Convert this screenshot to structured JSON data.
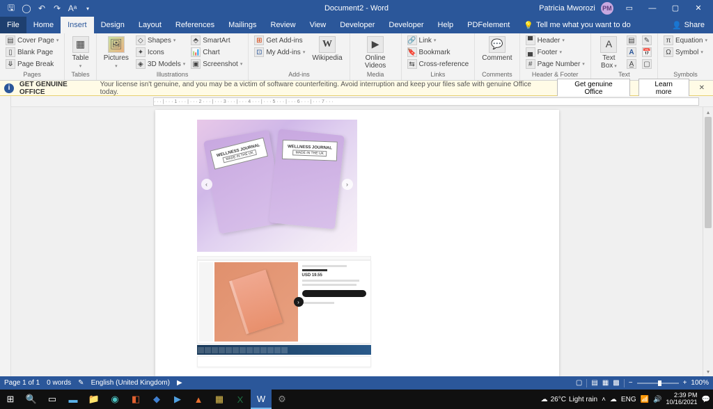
{
  "titlebar": {
    "doc_title": "Document2 - Word",
    "user_name": "Patricia Mworozi",
    "user_initials": "PM"
  },
  "tabs": {
    "file": "File",
    "items": [
      "Home",
      "Insert",
      "Design",
      "Layout",
      "References",
      "Mailings",
      "Review",
      "View",
      "Developer",
      "Developer",
      "Help",
      "PDFelement"
    ],
    "active_index": 1,
    "tell_me": "Tell me what you want to do",
    "share": "Share"
  },
  "ribbon": {
    "pages": {
      "label": "Pages",
      "cover": "Cover Page",
      "blank": "Blank Page",
      "break": "Page Break"
    },
    "tables": {
      "label": "Tables",
      "table": "Table"
    },
    "illustrations": {
      "label": "Illustrations",
      "pictures": "Pictures",
      "shapes": "Shapes",
      "icons": "Icons",
      "models": "3D Models",
      "smartart": "SmartArt",
      "chart": "Chart",
      "screenshot": "Screenshot"
    },
    "addins": {
      "label": "Add-ins",
      "get": "Get Add-ins",
      "my": "My Add-ins",
      "wikipedia": "Wikipedia"
    },
    "media": {
      "label": "Media",
      "video": "Online Videos"
    },
    "links": {
      "label": "Links",
      "link": "Link",
      "bookmark": "Bookmark",
      "crossref": "Cross-reference"
    },
    "comments": {
      "label": "Comments",
      "comment": "Comment"
    },
    "headerfooter": {
      "label": "Header & Footer",
      "header": "Header",
      "footer": "Footer",
      "pagenum": "Page Number"
    },
    "text": {
      "label": "Text",
      "textbox": "Text Box"
    },
    "symbols": {
      "label": "Symbols",
      "equation": "Equation",
      "symbol": "Symbol"
    }
  },
  "warning": {
    "title": "GET GENUINE OFFICE",
    "text": "Your license isn't genuine, and you may be a victim of software counterfeiting. Avoid interruption and keep your files safe with genuine Office today.",
    "btn1": "Get genuine Office",
    "btn2": "Learn more"
  },
  "document": {
    "journal_label": "WELLNESS JOURNAL",
    "journal_sub": "MADE IN THE UK",
    "price": "USD 19.55"
  },
  "status": {
    "page": "Page 1 of 1",
    "words": "0 words",
    "lang": "English (United Kingdom)",
    "zoom": "100%"
  },
  "taskbar": {
    "weather_temp": "26°C",
    "weather_cond": "Light rain",
    "lang": "ENG",
    "time": "2:39 PM",
    "date": "10/16/2021"
  }
}
